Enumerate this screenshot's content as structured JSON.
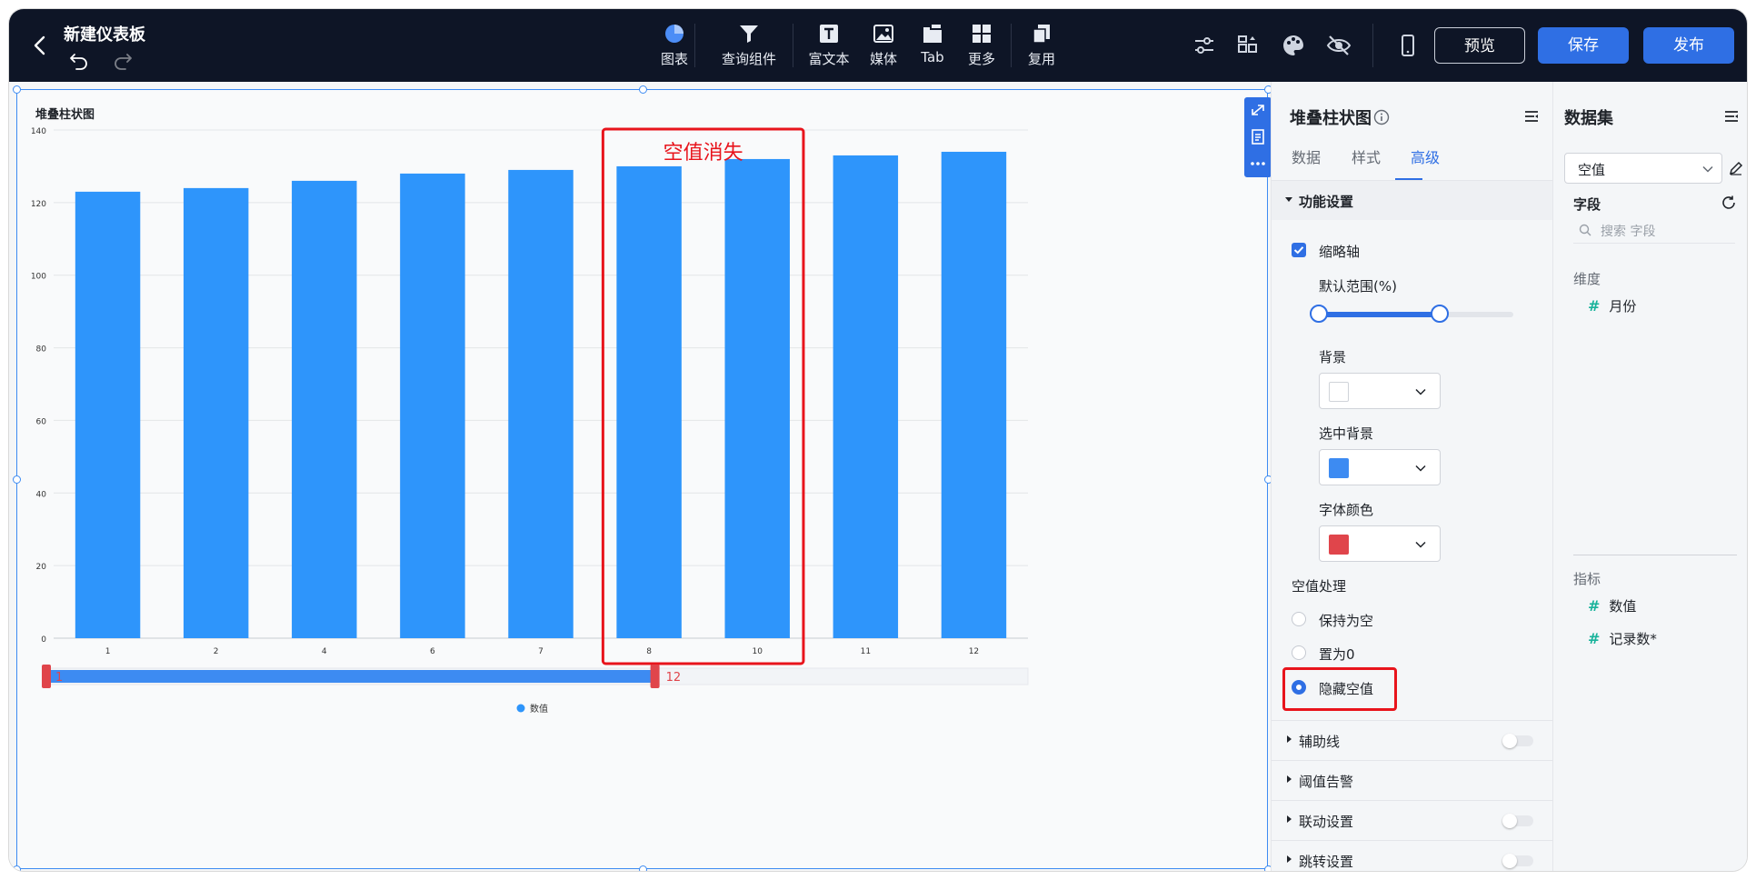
{
  "header": {
    "title": "新建仪表板",
    "tools": [
      {
        "label": "图表",
        "icon": "pie-chart-icon"
      },
      {
        "label": "查询组件",
        "icon": "filter-icon"
      },
      {
        "label": "富文本",
        "icon": "rich-text-icon"
      },
      {
        "label": "媒体",
        "icon": "image-icon"
      },
      {
        "label": "Tab",
        "icon": "tab-icon"
      },
      {
        "label": "更多",
        "icon": "grid-icon"
      },
      {
        "label": "复用",
        "icon": "copy-icon"
      }
    ],
    "preview_label": "预览",
    "save_label": "保存",
    "publish_label": "发布"
  },
  "chart_card": {
    "title": "堆叠柱状图",
    "annotation": "空值消失",
    "slider_start_label": "1",
    "slider_end_label": "12",
    "zoom_range_percent": [
      0,
      62
    ]
  },
  "chart_data": {
    "type": "bar",
    "categories": [
      "1",
      "2",
      "4",
      "6",
      "7",
      "8",
      "10",
      "11",
      "12"
    ],
    "series": [
      {
        "name": "数值",
        "values": [
          123,
          124,
          126,
          128,
          129,
          130,
          132,
          133,
          134
        ],
        "color": "#2e95fb"
      }
    ],
    "ylim": [
      0,
      140
    ],
    "yticks": [
      0,
      20,
      40,
      60,
      80,
      100,
      120,
      140
    ],
    "grid": true,
    "legend_position": "bottom-center"
  },
  "config_panel": {
    "title": "堆叠柱状图",
    "tabs": [
      "数据",
      "样式",
      "高级"
    ],
    "active_tab": "高级",
    "function_section": "功能设置",
    "thumbnail_axis_label": "缩略轴",
    "default_range_label": "默认范围(%)",
    "background_label": "背景",
    "background_color": "#ffffff",
    "selected_bg_label": "选中背景",
    "selected_bg_color": "#3d8bf2",
    "font_color_label": "字体颜色",
    "font_color": "#e0454b",
    "null_handling_label": "空值处理",
    "null_options": [
      "保持为空",
      "置为0",
      "隐藏空值"
    ],
    "null_selected": "隐藏空值",
    "collapsed_sections": [
      "辅助线",
      "阈值告警",
      "联动设置",
      "跳转设置"
    ]
  },
  "dataset_panel": {
    "title": "数据集",
    "selected_dataset": "空值",
    "fields_label": "字段",
    "search_placeholder": "搜索 字段",
    "dimensions_label": "维度",
    "dimensions": [
      "月份"
    ],
    "metrics_label": "指标",
    "metrics": [
      "数值",
      "记录数*"
    ]
  }
}
